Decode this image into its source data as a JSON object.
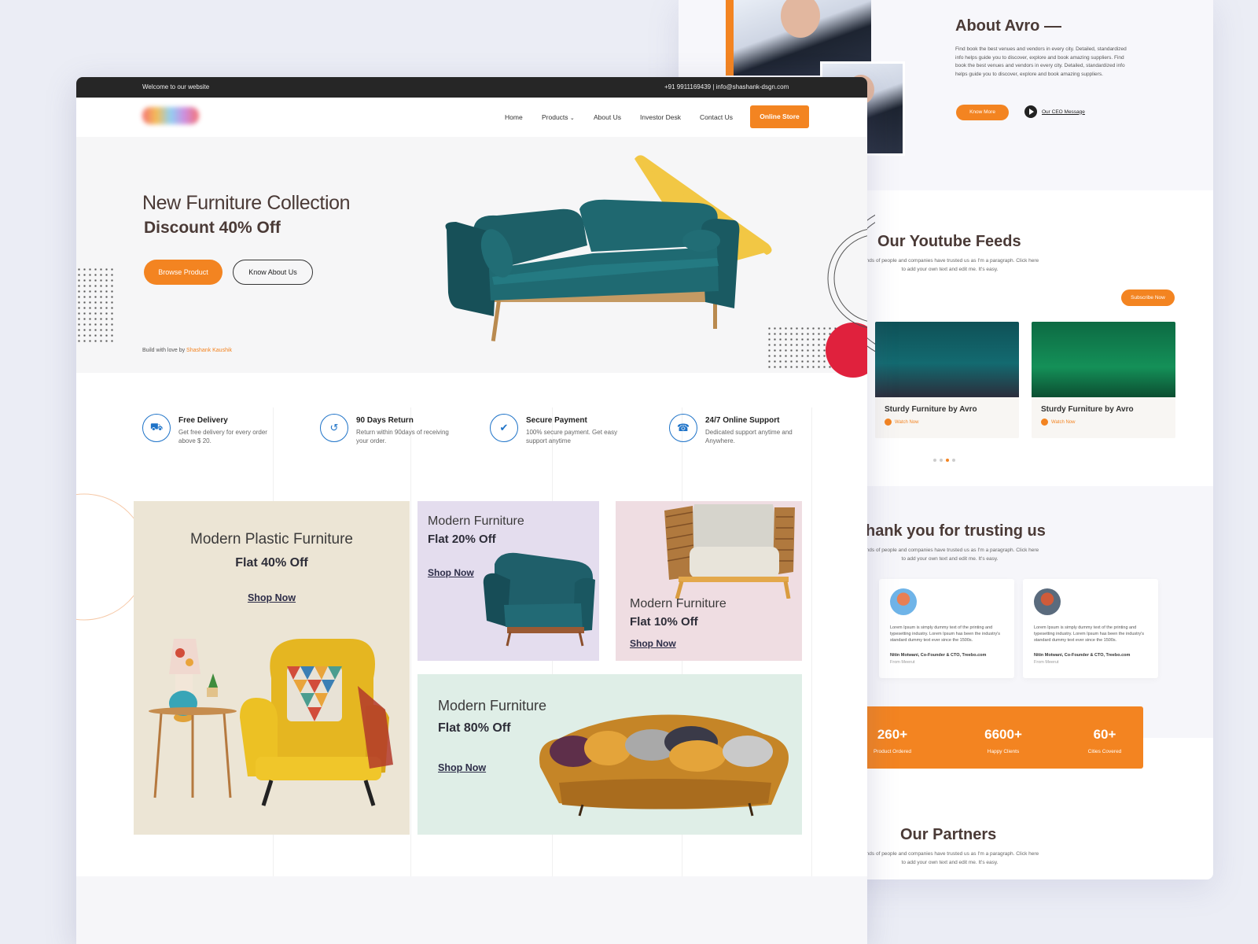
{
  "colors": {
    "accent": "#f38421",
    "brand_blue": "#1e73c8",
    "text_dark": "#4a3a36"
  },
  "back_page": {
    "about": {
      "title": "About Avro",
      "text": "Find book the best venues and vendors in every city. Detailed, standardized info helps guide you to discover, explore and book amazing suppliers. Find book the best venues and vendors in every city. Detailed, standardized info helps guide you to discover, explore and book amazing suppliers.",
      "know_more": "Know More",
      "ceo_label": "Our CEO Message"
    },
    "youtube": {
      "title": "Our Youtube Feeds",
      "subtitle": "sands of people and companies have trusted us as I'm a paragraph. Click here to add your own text and edit me. It's easy.",
      "subscribe": "Subscribe Now",
      "cards": [
        {
          "title": "Sturdy Furniture by Avro",
          "watch": "Watch Now"
        },
        {
          "title": "Sturdy Furniture by Avro",
          "watch": "Watch Now"
        }
      ]
    },
    "trust": {
      "title": "hank you for trusting us",
      "subtitle": "sands of people and companies have trusted us as I'm a paragraph. Click here to add your own text and edit me. It's easy.",
      "testimonials": [
        {
          "text": "Lorem Ipsum is simply dummy text of the printing and typesetting industry. Lorem Ipsum has been the industry's standard dummy text ever since the 1500s.",
          "name": "Nitin Motwani, Co-Founder & CTO, Treebo.com",
          "from": "From Meerut"
        },
        {
          "text": "Lorem Ipsum is simply dummy text of the printing and typesetting industry. Lorem Ipsum has been the industry's standard dummy text ever since the 1500s.",
          "name": "Nitin Motwani, Co-Founder & CTO, Treebo.com",
          "from": "From Meerut"
        }
      ]
    },
    "stats": [
      {
        "value": "260+",
        "label": "Product Ordered"
      },
      {
        "value": "6600+",
        "label": "Happy Clients"
      },
      {
        "value": "60+",
        "label": "Cities Covered"
      }
    ],
    "partners": {
      "title": "Our Partners",
      "subtitle": "sands of people and companies have trusted us as I'm a paragraph. Click here to add your own text and edit me. It's easy."
    }
  },
  "front_page": {
    "topbar": {
      "welcome": "Welcome to our website",
      "contact": "+91 9911169439  |  info@shashank-dsgn.com"
    },
    "nav": {
      "items": [
        "Home",
        "Products",
        "About Us",
        "Investor Desk",
        "Contact Us"
      ],
      "store": "Online Store"
    },
    "hero": {
      "title": "New Furniture Collection",
      "discount": "Discount 40% Off",
      "browse": "Browse Product",
      "know": "Know About Us",
      "credit_prefix": "Build with love by ",
      "credit_name": "Shashank Kaushik"
    },
    "features": [
      {
        "icon": "truck-icon",
        "title": "Free Delivery",
        "desc": "Get free delivery for every order above $ 20."
      },
      {
        "icon": "return-icon",
        "title": "90 Days Return",
        "desc": "Return within 90days of receiving your order."
      },
      {
        "icon": "secure-payment-icon",
        "title": "Secure Payment",
        "desc": "100% secure payment. Get easy support anytime"
      },
      {
        "icon": "headset-icon",
        "title": "24/7 Online Support",
        "desc": "Dedicated support  anytime and Anywhere."
      }
    ],
    "promos": {
      "plastic": {
        "title": "Modern Plastic Furniture",
        "offer": "Flat 40% Off",
        "cta": "Shop Now"
      },
      "armchair": {
        "title": "Modern Furniture",
        "offer": "Flat 20% Off",
        "cta": "Shop Now"
      },
      "wicker": {
        "title": "Modern Furniture",
        "offer": "Flat 10% Off",
        "cta": "Shop Now"
      },
      "sofa": {
        "title": "Modern Furniture",
        "offer": "Flat 80% Off",
        "cta": "Shop Now"
      }
    }
  }
}
